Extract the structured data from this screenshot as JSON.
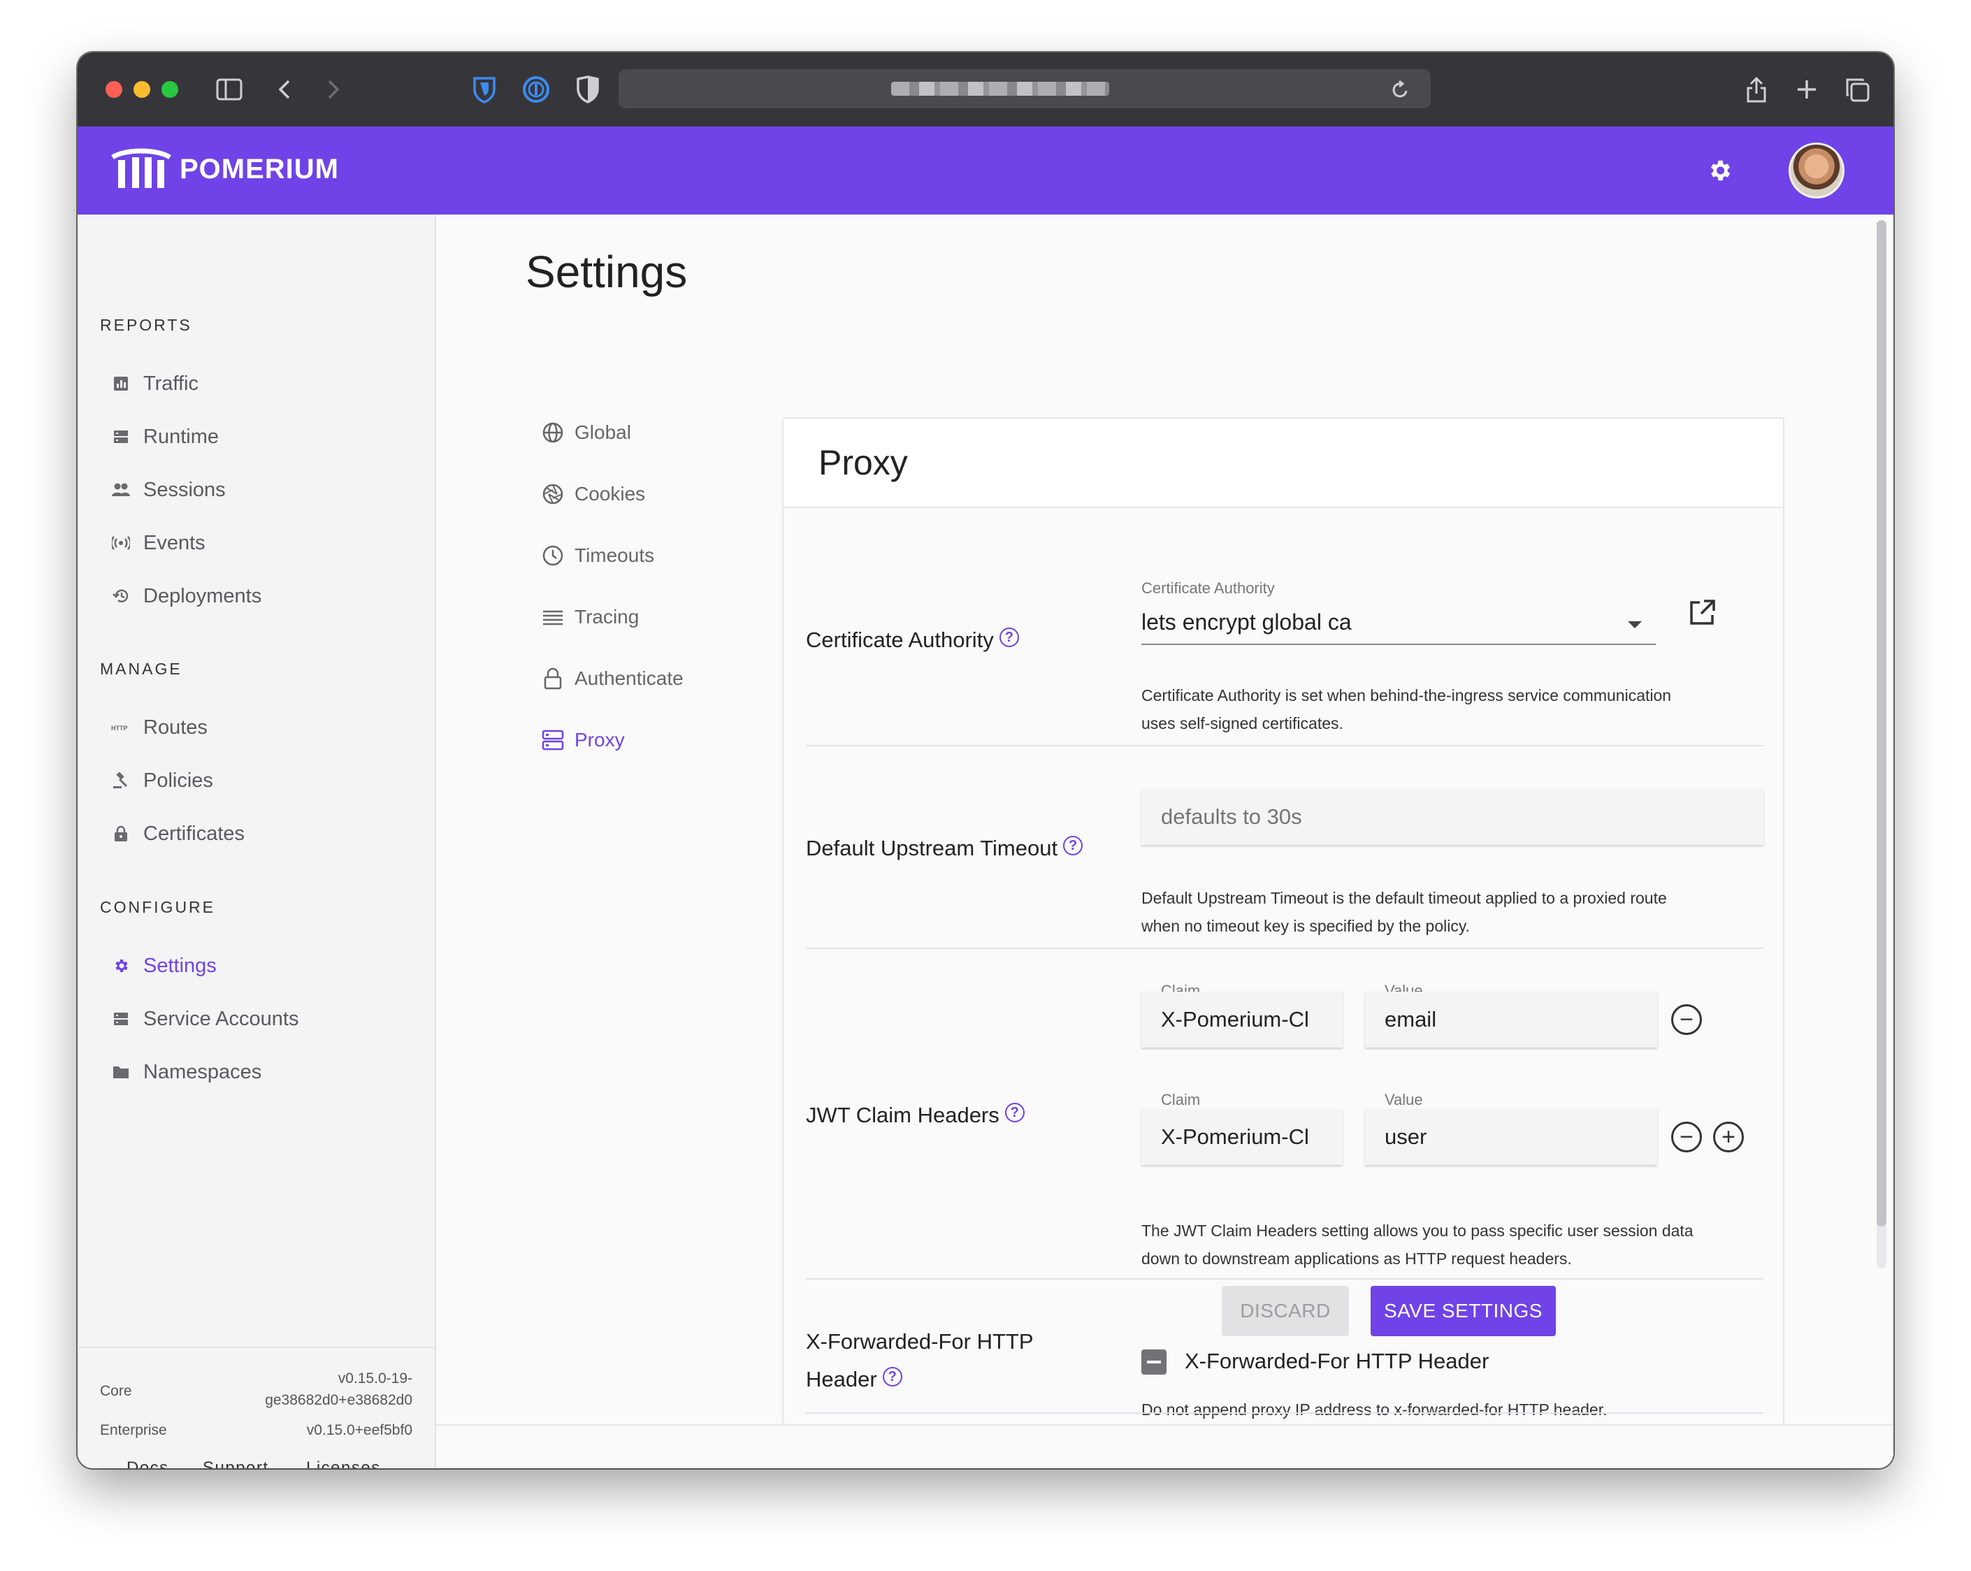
{
  "app": {
    "brand": "POMERIUM",
    "accent": "#6f43e7"
  },
  "sidebar": {
    "sections": [
      {
        "title": "REPORTS",
        "items": [
          {
            "label": "Traffic",
            "icon": "bar-chart-icon"
          },
          {
            "label": "Runtime",
            "icon": "server-icon"
          },
          {
            "label": "Sessions",
            "icon": "users-icon"
          },
          {
            "label": "Events",
            "icon": "broadcast-icon"
          },
          {
            "label": "Deployments",
            "icon": "history-icon"
          }
        ]
      },
      {
        "title": "MANAGE",
        "items": [
          {
            "label": "Routes",
            "icon": "http-icon"
          },
          {
            "label": "Policies",
            "icon": "gavel-icon"
          },
          {
            "label": "Certificates",
            "icon": "lock-icon"
          }
        ]
      },
      {
        "title": "CONFIGURE",
        "items": [
          {
            "label": "Settings",
            "icon": "gear-icon",
            "active": true
          },
          {
            "label": "Service Accounts",
            "icon": "server-icon"
          },
          {
            "label": "Namespaces",
            "icon": "folder-icon"
          }
        ]
      }
    ],
    "footer": {
      "core_label": "Core",
      "core_version_line1": "v0.15.0-19-",
      "core_version_line2": "ge38682d0+e38682d0",
      "enterprise_label": "Enterprise",
      "enterprise_version": "v0.15.0+eef5bf0",
      "links": [
        "Docs",
        "Support",
        "Licenses"
      ]
    }
  },
  "page": {
    "title": "Settings",
    "subnav": [
      {
        "label": "Global",
        "icon": "globe-icon"
      },
      {
        "label": "Cookies",
        "icon": "aperture-icon"
      },
      {
        "label": "Timeouts",
        "icon": "clock-icon"
      },
      {
        "label": "Tracing",
        "icon": "lines-icon"
      },
      {
        "label": "Authenticate",
        "icon": "lock-outline-icon"
      },
      {
        "label": "Proxy",
        "icon": "storage-icon",
        "active": true
      }
    ]
  },
  "proxy": {
    "title": "Proxy",
    "certificate_authority": {
      "label": "Certificate Authority",
      "field_label": "Certificate Authority",
      "value": "lets encrypt global ca",
      "hint_line1": "Certificate Authority is set when behind-the-ingress service communication",
      "hint_line2": "uses self-signed certificates."
    },
    "default_upstream_timeout": {
      "label": "Default Upstream Timeout",
      "placeholder": "defaults to 30s",
      "hint_line1": "Default Upstream Timeout is the default timeout applied to a proxied route",
      "hint_line2": "when no timeout key is specified by the policy."
    },
    "jwt_claim_headers": {
      "label": "JWT Claim Headers",
      "claim_label": "Claim",
      "value_label": "Value",
      "rows": [
        {
          "claim": "X-Pomerium-Cl",
          "value": "email"
        },
        {
          "claim": "X-Pomerium-Cl",
          "value": "user"
        }
      ],
      "hint_line1": "The JWT Claim Headers setting allows you to pass specific user session data",
      "hint_line2": "down to downstream applications as HTTP request headers."
    },
    "x_forwarded_for": {
      "label_line1": "X-Forwarded-For HTTP",
      "label_line2": "Header",
      "checkbox_label": "X-Forwarded-For HTTP Header",
      "hint": "Do not append proxy IP address to x-forwarded-for HTTP header."
    }
  },
  "actions": {
    "discard": "DISCARD",
    "save": "SAVE SETTINGS"
  }
}
